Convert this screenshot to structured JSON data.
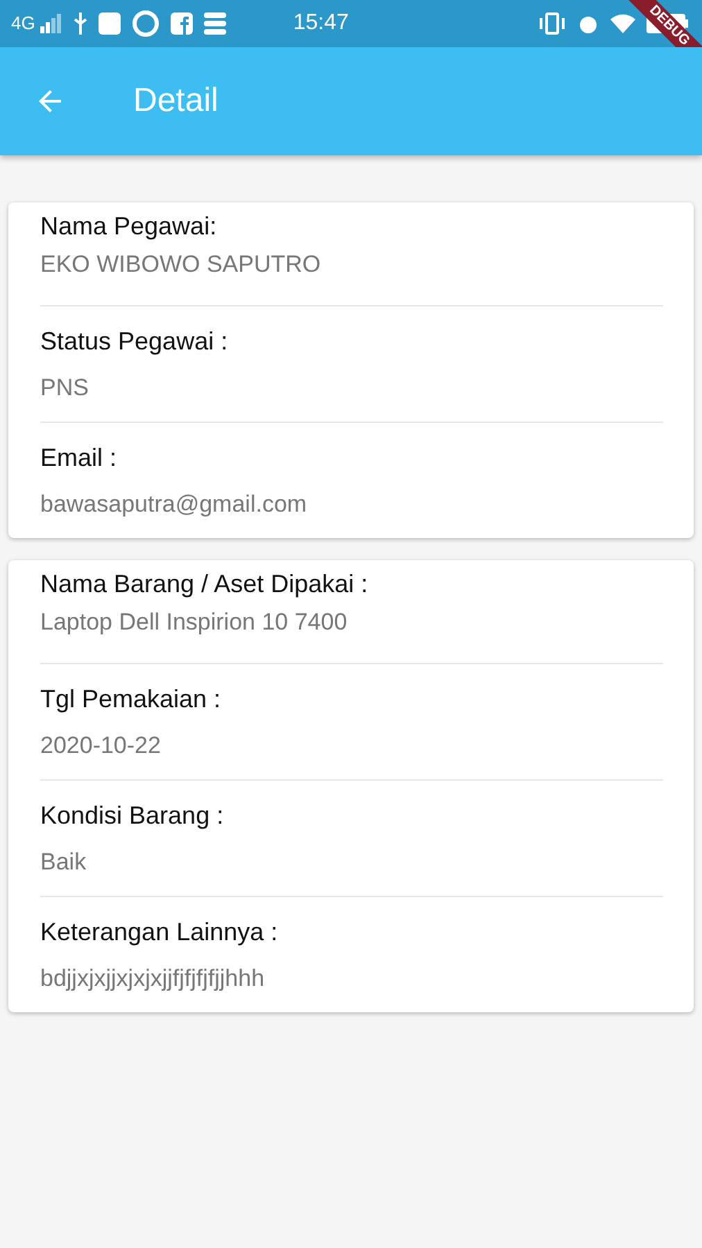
{
  "status_bar": {
    "network": "4G",
    "time": "15:47"
  },
  "debug_banner": "DEBUG",
  "app_bar": {
    "title": "Detail"
  },
  "cards": [
    {
      "fields": [
        {
          "label": "Nama Pegawai:",
          "value": "EKO WIBOWO SAPUTRO"
        },
        {
          "label": "Status Pegawai :",
          "value": "PNS"
        },
        {
          "label": "Email :",
          "value": "bawasaputra@gmail.com"
        }
      ]
    },
    {
      "fields": [
        {
          "label": "Nama Barang / Aset Dipakai :",
          "value": "Laptop Dell Inspirion 10 7400"
        },
        {
          "label": "Tgl Pemakaian :",
          "value": "2020-10-22"
        },
        {
          "label": "Kondisi Barang :",
          "value": "Baik"
        },
        {
          "label": "Keterangan Lainnya :",
          "value": "bdjjxjxjjxjxjxjjfjfjfjfjjhhh"
        }
      ]
    }
  ]
}
